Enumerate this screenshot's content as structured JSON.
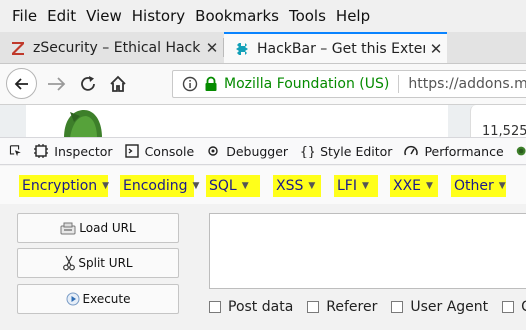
{
  "menubar": {
    "items": [
      "File",
      "Edit",
      "View",
      "History",
      "Bookmarks",
      "Tools",
      "Help"
    ]
  },
  "tabs": [
    {
      "label": "zSecurity – Ethical Hacki",
      "icon": "zsecurity-icon",
      "active": false
    },
    {
      "label": "HackBar – Get this Exten",
      "icon": "puzzle-icon",
      "active": true
    }
  ],
  "navbar": {
    "site_identity": "Mozilla Foundation (US)",
    "url": "https://addons.m"
  },
  "page_peek": {
    "count_text": "11,525"
  },
  "devtools": {
    "tabs": [
      "Inspector",
      "Console",
      "Debugger",
      "Style Editor",
      "Performance"
    ]
  },
  "hackbar": {
    "menu": [
      "Encryption",
      "Encoding",
      "SQL",
      "XSS",
      "LFI",
      "XXE",
      "Other"
    ],
    "buttons": {
      "load": "Load URL",
      "split": "Split URL",
      "execute": "Execute"
    },
    "options": [
      "Post data",
      "Referer",
      "User Agent",
      "Co"
    ]
  },
  "colors": {
    "highlight": "#ffff1a",
    "accent": "#0a84ff",
    "secure_green": "#058b00"
  }
}
